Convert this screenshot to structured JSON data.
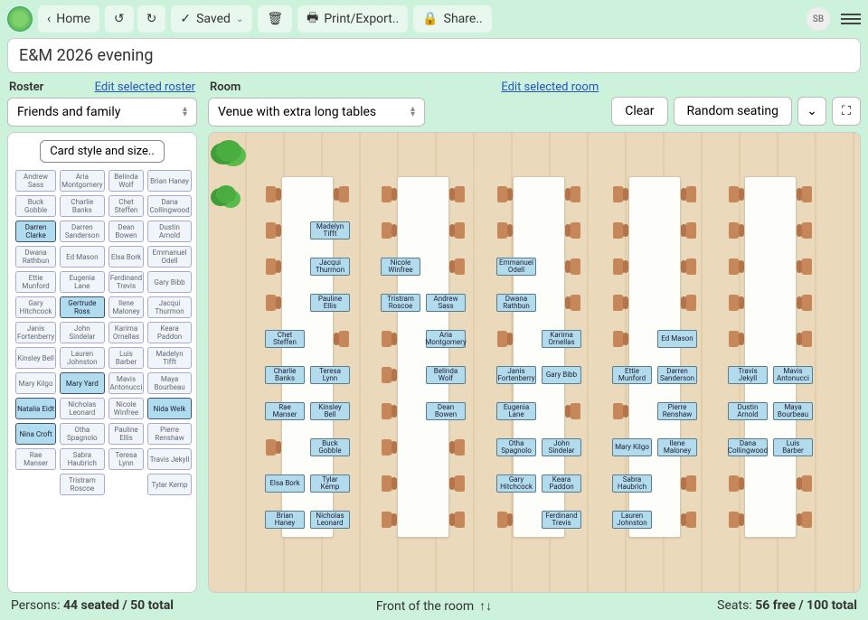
{
  "toolbar": {
    "home": "Home",
    "saved": "Saved",
    "print": "Print/Export..",
    "share": "Share..",
    "avatar": "SB"
  },
  "title": "E&M 2026 evening",
  "roster": {
    "label": "Roster",
    "edit_link": "Edit selected roster",
    "selected": "Friends and family",
    "card_style_btn": "Card style and size..",
    "cells": [
      {
        "name": "Andrew Sass",
        "active": false
      },
      {
        "name": "Aria Montgomery",
        "active": false
      },
      {
        "name": "Belinda Wolf",
        "active": false
      },
      {
        "name": "Brian Haney",
        "active": false
      },
      {
        "name": "Buck Gobble",
        "active": false
      },
      {
        "name": "Charlie Banks",
        "active": false
      },
      {
        "name": "Chet Steffen",
        "active": false
      },
      {
        "name": "Dana Collingwood",
        "active": false
      },
      {
        "name": "Darren Clarke",
        "active": true
      },
      {
        "name": "Darren Sanderson",
        "active": false
      },
      {
        "name": "Dean Bowen",
        "active": false
      },
      {
        "name": "Dustin Arnold",
        "active": false
      },
      {
        "name": "Dwana Rathbun",
        "active": false
      },
      {
        "name": "Ed Mason",
        "active": false
      },
      {
        "name": "Elsa Bork",
        "active": false
      },
      {
        "name": "Emmanuel Odell",
        "active": false
      },
      {
        "name": "Ettie Munford",
        "active": false
      },
      {
        "name": "Eugenia Lane",
        "active": false
      },
      {
        "name": "Ferdinand Trevis",
        "active": false
      },
      {
        "name": "Gary Bibb",
        "active": false
      },
      {
        "name": "Gary Hitchcock",
        "active": false
      },
      {
        "name": "Gertrude Ross",
        "active": true
      },
      {
        "name": "Ilene Maloney",
        "active": false
      },
      {
        "name": "Jacqui Thurmon",
        "active": false
      },
      {
        "name": "Janis Fortenberry",
        "active": false
      },
      {
        "name": "John Sindelar",
        "active": false
      },
      {
        "name": "Karima Ornellas",
        "active": false
      },
      {
        "name": "Keara Paddon",
        "active": false
      },
      {
        "name": "Kinsley Bell",
        "active": false
      },
      {
        "name": "Lauren Johnston",
        "active": false
      },
      {
        "name": "Luis Barber",
        "active": false
      },
      {
        "name": "Madelyn Tifft",
        "active": false
      },
      {
        "name": "Mary Kilgo",
        "active": false
      },
      {
        "name": "Mary Yard",
        "active": true
      },
      {
        "name": "Mavis Antonucci",
        "active": false
      },
      {
        "name": "Maya Bourbeau",
        "active": false
      },
      {
        "name": "Natalia Eidt",
        "active": true
      },
      {
        "name": "Nicholas Leonard",
        "active": false
      },
      {
        "name": "Nicole Winfree",
        "active": false
      },
      {
        "name": "Nida Welk",
        "active": true
      },
      {
        "name": "Nina Croft",
        "active": true
      },
      {
        "name": "Otha Spagnolo",
        "active": false
      },
      {
        "name": "Pauline Ellis",
        "active": false
      },
      {
        "name": "Pierre Renshaw",
        "active": false
      },
      {
        "name": "Rae Manser",
        "active": false
      },
      {
        "name": "Sabra Haubrich",
        "active": false
      },
      {
        "name": "Teresa Lynn",
        "active": false
      },
      {
        "name": "Travis Jekyll",
        "active": false
      },
      {
        "name": "",
        "active": false,
        "empty": true
      },
      {
        "name": "Tristram Roscoe",
        "active": false
      },
      {
        "name": "",
        "active": false,
        "empty": true
      },
      {
        "name": "Tylar Kemp",
        "active": false
      }
    ]
  },
  "room": {
    "label": "Room",
    "edit_link": "Edit selected room",
    "selected": "Venue with extra long tables",
    "clear_btn": "Clear",
    "random_btn": "Random seating",
    "front_label": "Front of the room"
  },
  "seated_cards": {
    "t0": [
      {
        "name": "Madelyn Tifft",
        "col": 1,
        "row": 1
      },
      {
        "name": "Jacqui Thurmon",
        "col": 1,
        "row": 2
      },
      {
        "name": "Pauline Ellis",
        "col": 1,
        "row": 3
      },
      {
        "name": "Chet Steffen",
        "col": 0,
        "row": 4
      },
      {
        "name": "Charlie Banks",
        "col": 0,
        "row": 5
      },
      {
        "name": "Teresa Lynn",
        "col": 1,
        "row": 5
      },
      {
        "name": "Rae Manser",
        "col": 0,
        "row": 6
      },
      {
        "name": "Kinsley Bell",
        "col": 1,
        "row": 6
      },
      {
        "name": "Buck Gobble",
        "col": 1,
        "row": 7
      },
      {
        "name": "Elsa Bork",
        "col": 0,
        "row": 8
      },
      {
        "name": "Tylar Kemp",
        "col": 1,
        "row": 8
      },
      {
        "name": "Brian Haney",
        "col": 0,
        "row": 9
      },
      {
        "name": "Nicholas Leonard",
        "col": 1,
        "row": 9
      }
    ],
    "t1": [
      {
        "name": "Nicole Winfree",
        "col": 0,
        "row": 2
      },
      {
        "name": "Tristram Roscoe",
        "col": 0,
        "row": 3
      },
      {
        "name": "Andrew Sass",
        "col": 1,
        "row": 3
      },
      {
        "name": "Aria Montgomery",
        "col": 1,
        "row": 4
      },
      {
        "name": "Belinda Wolf",
        "col": 1,
        "row": 5
      },
      {
        "name": "Dean Bowen",
        "col": 1,
        "row": 6
      }
    ],
    "t2": [
      {
        "name": "Emmanuel Odell",
        "col": 0,
        "row": 2
      },
      {
        "name": "Dwana Rathbun",
        "col": 0,
        "row": 3
      },
      {
        "name": "Karima Ornellas",
        "col": 1,
        "row": 4
      },
      {
        "name": "Janis Fortenberry",
        "col": 0,
        "row": 5
      },
      {
        "name": "Gary Bibb",
        "col": 1,
        "row": 5
      },
      {
        "name": "Eugenia Lane",
        "col": 0,
        "row": 6
      },
      {
        "name": "Otha Spagnolo",
        "col": 0,
        "row": 7
      },
      {
        "name": "John Sindelar",
        "col": 1,
        "row": 7
      },
      {
        "name": "Gary Hitchcock",
        "col": 0,
        "row": 8
      },
      {
        "name": "Keara Paddon",
        "col": 1,
        "row": 8
      },
      {
        "name": "Ferdinand Trevis",
        "col": 1,
        "row": 9
      }
    ],
    "t3": [
      {
        "name": "Ed Mason",
        "col": 1,
        "row": 4
      },
      {
        "name": "Ettie Munford",
        "col": 0,
        "row": 5
      },
      {
        "name": "Darren Sanderson",
        "col": 1,
        "row": 5
      },
      {
        "name": "Pierre Renshaw",
        "col": 1,
        "row": 6
      },
      {
        "name": "Mary Kilgo",
        "col": 0,
        "row": 7
      },
      {
        "name": "Ilene Maloney",
        "col": 1,
        "row": 7
      },
      {
        "name": "Sabra Haubrich",
        "col": 0,
        "row": 8
      },
      {
        "name": "Lauren Johnston",
        "col": 0,
        "row": 9
      }
    ],
    "t4": [
      {
        "name": "Travis Jekyll",
        "col": 0,
        "row": 5
      },
      {
        "name": "Mavis Antonucci",
        "col": 1,
        "row": 5
      },
      {
        "name": "Dustin Arnold",
        "col": 0,
        "row": 6
      },
      {
        "name": "Maya Bourbeau",
        "col": 1,
        "row": 6
      },
      {
        "name": "Dana Collingwood",
        "col": 0,
        "row": 7
      },
      {
        "name": "Luis Barber",
        "col": 1,
        "row": 7
      }
    ]
  },
  "footer": {
    "persons_label": "Persons:",
    "persons_value": "44 seated / 50 total",
    "front": "Front of the room",
    "seats_label": "Seats:",
    "seats_value": "56 free / 100 total"
  }
}
